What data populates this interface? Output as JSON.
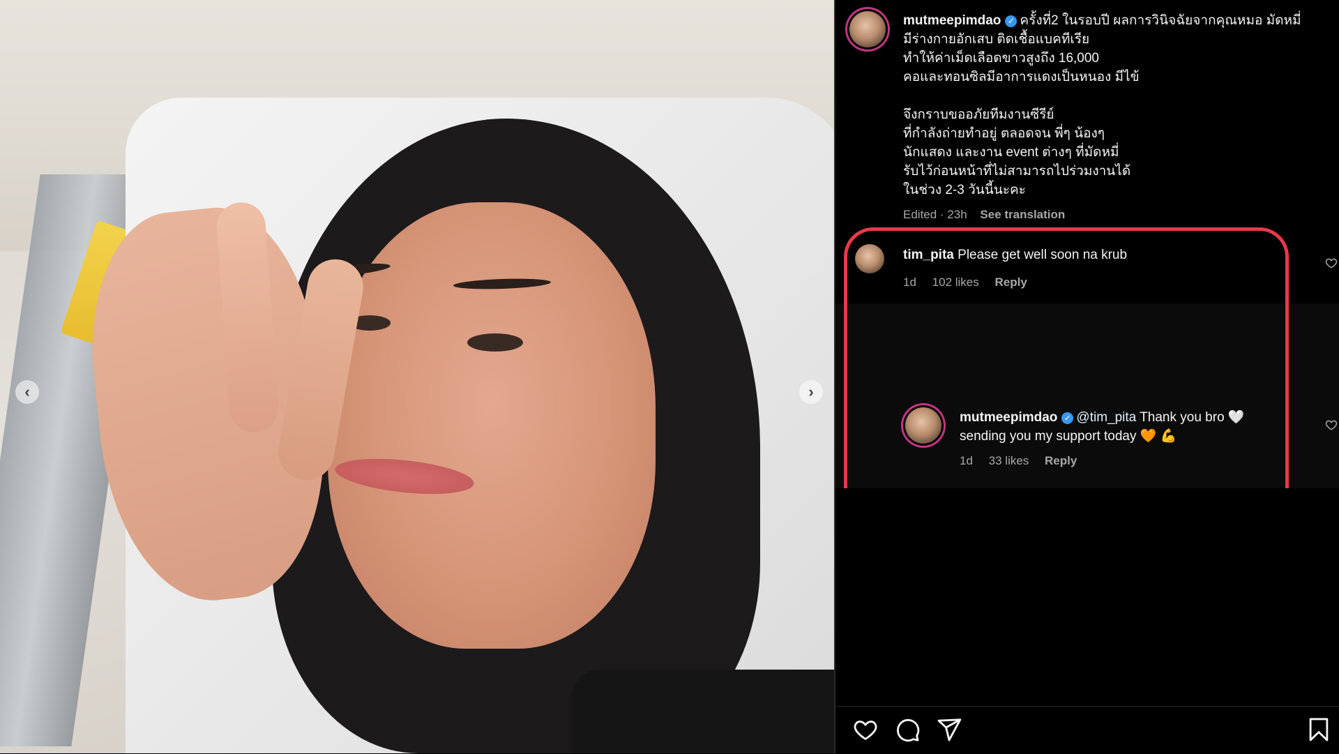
{
  "photo": {
    "prev_arrow": "‹",
    "next_arrow": "›"
  },
  "post": {
    "username": "mutmeepimdao",
    "verified_badge": "✓",
    "caption_lines": [
      "ครั้งที่2 ในรอบปี ผลการวินิจฉัยจากคุณหมอ มัดหมี่",
      "มีร่างกายอักเสบ ติดเชื้อแบคทีเรีย",
      "ทำให้ค่าเม็ดเลือดขาวสูงถึง 16,000",
      "คอและทอนซิลมีอาการแดงเป็นหนอง มีไข้",
      "",
      "จึงกราบขออภัยทีมงานซีรีย์",
      "ที่กำลังถ่ายทำอยู่ ตลอดจน พี่ๆ น้องๆ",
      "นักแสดง และงาน event ต่างๆ ที่มัดหมี่",
      "รับไว้ก่อนหน้าที่ไม่สามารถไปร่วมงานได้",
      "ในช่วง 2-3 วันนี้นะคะ"
    ],
    "meta": "Edited · 23h",
    "see_translation": "See translation"
  },
  "comments": [
    {
      "username": "tim_pita",
      "text": "Please get well soon na krub",
      "time": "1d",
      "likes": "102 likes",
      "reply": "Reply"
    },
    {
      "username": "mutmeepimdao",
      "mention": "@tim_pita",
      "text_line1": "Thank you bro 🤍",
      "text_line2": "sending you my support today 🧡 💪",
      "time": "1d",
      "likes": "33 likes",
      "reply": "Reply"
    }
  ],
  "icons": {
    "like": "heart-icon",
    "comment": "comment-icon",
    "share": "send-icon",
    "save": "bookmark-icon"
  },
  "colors": {
    "highlight_border": "#e8394a",
    "verified": "#3897f0",
    "story_ring": "#c13584"
  }
}
